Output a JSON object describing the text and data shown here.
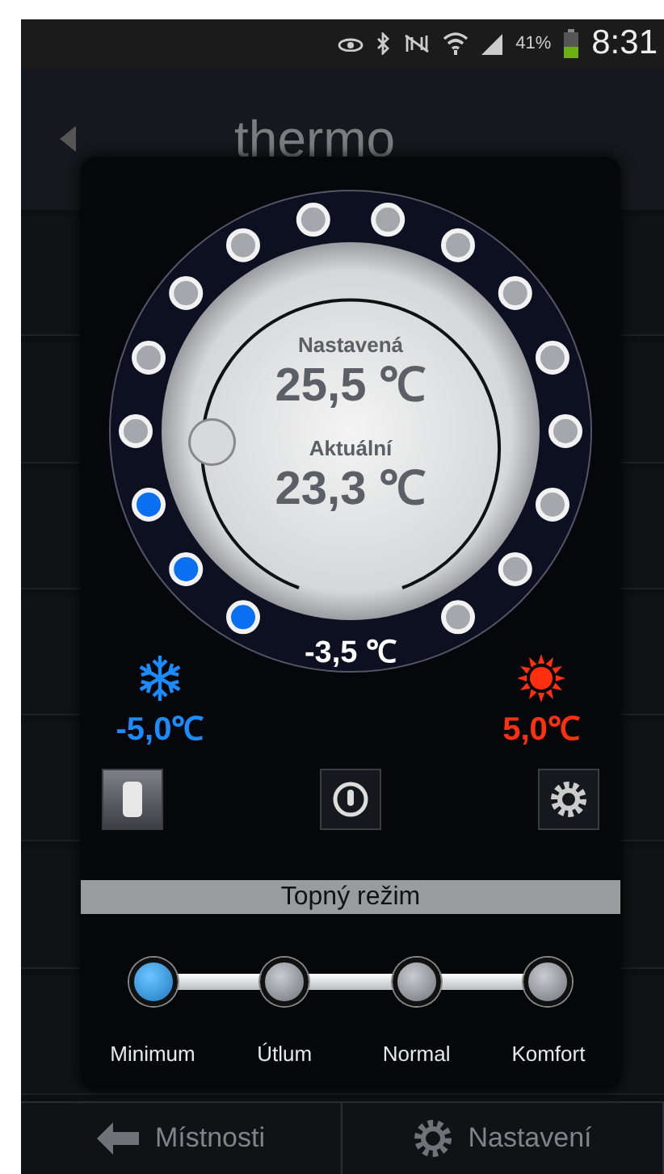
{
  "status_bar": {
    "battery": "41%",
    "time": "8:31"
  },
  "header": {
    "title": "thermo"
  },
  "dial": {
    "setpoint_label": "Nastavená",
    "setpoint": "25,5 ℃",
    "actual_label": "Aktuální",
    "actual": "23,3 ℃",
    "offset": "-3,5 ℃",
    "level": 0.15,
    "dots": [
      {
        "on": true
      },
      {
        "on": true
      },
      {
        "on": true
      },
      {
        "on": false
      },
      {
        "on": false
      },
      {
        "on": false
      },
      {
        "on": false
      },
      {
        "on": false
      },
      {
        "on": false
      },
      {
        "on": false
      },
      {
        "on": false
      },
      {
        "on": false
      },
      {
        "on": false
      },
      {
        "on": false
      },
      {
        "on": false
      },
      {
        "on": false
      }
    ]
  },
  "limits": {
    "min": "-5,0℃",
    "max": "5,0℃"
  },
  "mode_title": "Topný režim",
  "modes": [
    {
      "label": "Minimum",
      "selected": true
    },
    {
      "label": "Útlum",
      "selected": false
    },
    {
      "label": "Normal",
      "selected": false
    },
    {
      "label": "Komfort",
      "selected": false
    }
  ],
  "bottom_bar": [
    {
      "label": "Místnosti",
      "kind": "back"
    },
    {
      "label": "Nastavení",
      "kind": "settings"
    }
  ]
}
